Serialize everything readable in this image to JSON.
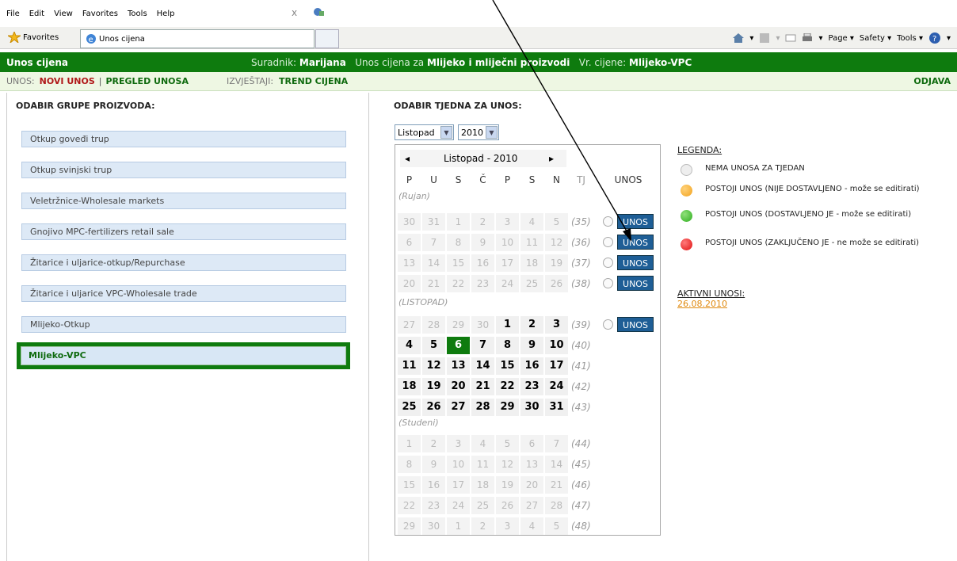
{
  "menu": {
    "items": [
      "File",
      "Edit",
      "View",
      "Favorites",
      "Tools",
      "Help"
    ],
    "close": "x"
  },
  "browser": {
    "favorites": "Favorites",
    "tab_title": "Unos cijena",
    "cmd": {
      "page": "Page",
      "safety": "Safety",
      "tools": "Tools"
    }
  },
  "app": {
    "title": "Unos cijena",
    "info_user_lbl": "Suradnik:",
    "user": "Marijana",
    "info_unos_lbl": "Unos cijena za",
    "product": "Mlijeko i mliječni proizvodi",
    "info_vr_lbl": "Vr. cijene:",
    "vr": "Mlijeko-VPC"
  },
  "nav": {
    "unos_lbl": "UNOS:",
    "novi": "NOVI UNOS",
    "sep": "|",
    "pregled": "PREGLED UNOSA",
    "izv_lbl": "IZVJEŠTAJI:",
    "trend": "TREND CIJENA",
    "odjava": "ODJAVA"
  },
  "left": {
    "heading": "ODABIR GRUPE PROIZVODA:",
    "groups": [
      "Otkup goveđi trup",
      "Otkup svinjski trup",
      "Veletržnice-Wholesale markets",
      "Gnojivo MPC-fertilizers retail sale",
      "Žitarice i uljarice-otkup/Repurchase",
      "Žitarice i uljarice VPC-Wholesale trade",
      "Mlijeko-Otkup",
      "Mlijeko-VPC"
    ]
  },
  "right": {
    "heading": "ODABIR TJEDNA ZA UNOS:",
    "month_select": "Listopad",
    "year_select": "2010"
  },
  "calendar": {
    "prev": "◂",
    "next": "▸",
    "title": "Listopad - 2010",
    "days": [
      "P",
      "U",
      "S",
      "Č",
      "P",
      "S",
      "N"
    ],
    "tj": "TJ",
    "unos_col": "UNOS",
    "unos_btn": "UNOS",
    "rujan": "(Rujan)",
    "listopad": "(LISTOPAD)",
    "studeni": "(Studeni)",
    "weeks": [
      {
        "d": [
          "30",
          "31",
          "1",
          "2",
          "3",
          "4",
          "5"
        ],
        "w": "(35)"
      },
      {
        "d": [
          "6",
          "7",
          "8",
          "9",
          "10",
          "11",
          "12"
        ],
        "w": "(36)"
      },
      {
        "d": [
          "13",
          "14",
          "15",
          "16",
          "17",
          "18",
          "19"
        ],
        "w": "(37)"
      },
      {
        "d": [
          "20",
          "21",
          "22",
          "23",
          "24",
          "25",
          "26"
        ],
        "w": "(38)"
      },
      {
        "d": [
          "27",
          "28",
          "29",
          "30",
          "1",
          "2",
          "3"
        ],
        "w": "(39)"
      },
      {
        "d": [
          "4",
          "5",
          "6",
          "7",
          "8",
          "9",
          "10"
        ],
        "w": "(40)"
      },
      {
        "d": [
          "11",
          "12",
          "13",
          "14",
          "15",
          "16",
          "17"
        ],
        "w": "(41)"
      },
      {
        "d": [
          "18",
          "19",
          "20",
          "21",
          "22",
          "23",
          "24"
        ],
        "w": "(42)"
      },
      {
        "d": [
          "25",
          "26",
          "27",
          "28",
          "29",
          "30",
          "31"
        ],
        "w": "(43)"
      },
      {
        "d": [
          "1",
          "2",
          "3",
          "4",
          "5",
          "6",
          "7"
        ],
        "w": "(44)"
      },
      {
        "d": [
          "8",
          "9",
          "10",
          "11",
          "12",
          "13",
          "14"
        ],
        "w": "(45)"
      },
      {
        "d": [
          "15",
          "16",
          "17",
          "18",
          "19",
          "20",
          "21"
        ],
        "w": "(46)"
      },
      {
        "d": [
          "22",
          "23",
          "24",
          "25",
          "26",
          "27",
          "28"
        ],
        "w": "(47)"
      },
      {
        "d": [
          "29",
          "30",
          "1",
          "2",
          "3",
          "4",
          "5"
        ],
        "w": "(48)"
      }
    ]
  },
  "legend": {
    "title": "LEGENDA:",
    "items": [
      {
        "text": "NEMA UNOSA ZA TJEDAN",
        "color": "#eeeeee"
      },
      {
        "text": "POSTOJI UNOS (NIJE DOSTAVLJENO - može se editirati)",
        "color": "#f2a21e"
      },
      {
        "text": "POSTOJI UNOS (DOSTAVLJENO JE - može se editirati)",
        "color": "#2fae1f"
      },
      {
        "text": "POSTOJI UNOS (ZAKLJUČENO JE - ne može se editirati)",
        "color": "#e01010"
      }
    ]
  },
  "aktivni": {
    "title": "AKTIVNI UNOSI:",
    "date": "26.08.2010"
  },
  "colors": {
    "green": "#0e7b0e",
    "button": "#1e5e96"
  }
}
